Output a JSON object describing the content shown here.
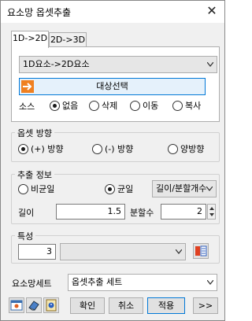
{
  "window": {
    "title": "요소망 옵셋추출",
    "close_glyph": "✕"
  },
  "tabs": [
    {
      "label": "1D->2D",
      "active": true
    },
    {
      "label": "2D->3D",
      "active": false
    }
  ],
  "tab1": {
    "mode_combo_value": "1D요소->2D요소",
    "target_button_label": "대상선택",
    "source_label": "소스",
    "source_options": [
      {
        "label": "없음",
        "selected": true
      },
      {
        "label": "삭제",
        "selected": false
      },
      {
        "label": "이동",
        "selected": false
      },
      {
        "label": "복사",
        "selected": false
      }
    ]
  },
  "offset_direction": {
    "title": "옵셋 방향",
    "options": [
      {
        "label": "(+) 방향",
        "selected": true
      },
      {
        "label": "(-) 방향",
        "selected": false
      },
      {
        "label": "양방향",
        "selected": false
      }
    ]
  },
  "extract_info": {
    "title": "추출 정보",
    "options": [
      {
        "label": "비균일",
        "selected": false
      },
      {
        "label": "균일",
        "selected": true
      }
    ],
    "method_combo_value": "길이/분할개수",
    "length_label": "길이",
    "length_value": "1.5",
    "divisions_label": "분할수",
    "divisions_value": "2"
  },
  "property": {
    "title": "특성",
    "id_value": "3",
    "combo_value": ""
  },
  "mesh_set": {
    "label": "요소망세트",
    "combo_value": "옵셋추출 세트"
  },
  "buttons": {
    "confirm": "확인",
    "cancel": "취소",
    "apply": "적용",
    "more": ">>"
  },
  "colors": {
    "accent": "#0078d7",
    "target_button_bg": "#e5f1fb"
  }
}
